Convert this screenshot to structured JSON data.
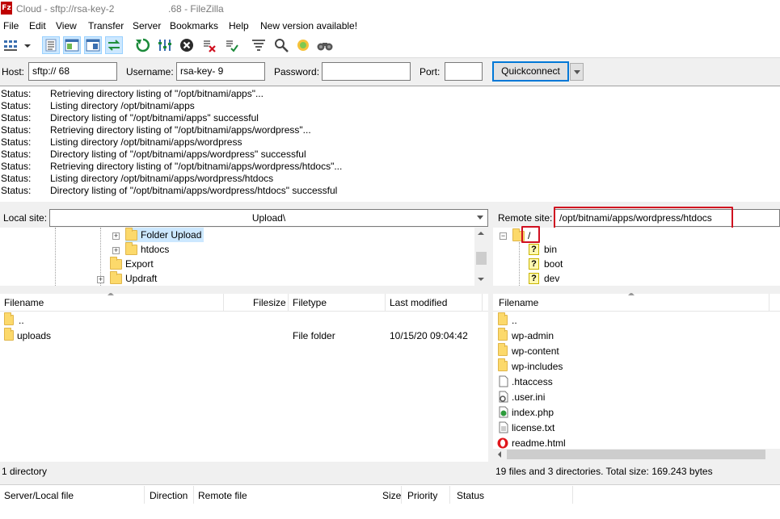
{
  "title": {
    "text": "Cloud - sftp://rsa-key-2                    .68 - FileZilla",
    "icon_letter": "Fz"
  },
  "menu": [
    "File",
    "Edit",
    "View",
    "Transfer",
    "Server",
    "Bookmarks",
    "Help",
    "New version available!"
  ],
  "toolbar_icons": [
    "site-manager-icon",
    "toggle-message-log-icon",
    "toggle-local-tree-icon",
    "toggle-remote-tree-icon",
    "toggle-queue-icon",
    "refresh-icon",
    "process-queue-icon",
    "cancel-icon",
    "disconnect-icon",
    "reconnect-icon",
    "directory-filter-icon",
    "search-remote-icon",
    "compare-icon",
    "find-files-icon"
  ],
  "quickconnect": {
    "host_label": "Host:",
    "host_value": "sftp://            68",
    "username_label": "Username:",
    "username_value": "rsa-key-            9",
    "password_label": "Password:",
    "password_value": "",
    "port_label": "Port:",
    "port_value": "",
    "button": "Quickconnect"
  },
  "log": [
    {
      "label": "Status:",
      "msg": "Retrieving directory listing of \"/opt/bitnami/apps\"..."
    },
    {
      "label": "Status:",
      "msg": "Listing directory /opt/bitnami/apps"
    },
    {
      "label": "Status:",
      "msg": "Directory listing of \"/opt/bitnami/apps\" successful"
    },
    {
      "label": "Status:",
      "msg": "Retrieving directory listing of \"/opt/bitnami/apps/wordpress\"..."
    },
    {
      "label": "Status:",
      "msg": "Listing directory /opt/bitnami/apps/wordpress"
    },
    {
      "label": "Status:",
      "msg": "Directory listing of \"/opt/bitnami/apps/wordpress\" successful"
    },
    {
      "label": "Status:",
      "msg": "Retrieving directory listing of \"/opt/bitnami/apps/wordpress/htdocs\"..."
    },
    {
      "label": "Status:",
      "msg": "Listing directory /opt/bitnami/apps/wordpress/htdocs"
    },
    {
      "label": "Status:",
      "msg": "Directory listing of \"/opt/bitnami/apps/wordpress/htdocs\" successful"
    }
  ],
  "local": {
    "label": "Local site:",
    "path": "Upload\\",
    "tree": [
      "Folder Upload",
      "htdocs",
      "Export",
      "Updraft"
    ],
    "columns": [
      "Filename",
      "Filesize",
      "Filetype",
      "Last modified"
    ],
    "files": [
      {
        "name": "..",
        "size": "",
        "type": "",
        "modified": ""
      },
      {
        "name": "uploads",
        "size": "",
        "type": "File folder",
        "modified": "10/15/20 09:04:42"
      }
    ],
    "status": "1 directory"
  },
  "remote": {
    "label": "Remote site:",
    "path": "/opt/bitnami/apps/wordpress/htdocs",
    "tree": [
      "/",
      "bin",
      "boot",
      "dev"
    ],
    "columns": [
      "Filename"
    ],
    "files": [
      "..",
      "wp-admin",
      "wp-content",
      "wp-includes",
      ".htaccess",
      ".user.ini",
      "index.php",
      "license.txt",
      "readme.html"
    ],
    "status": "19 files and 3 directories. Total size: 169.243 bytes"
  },
  "queue_columns": [
    "Server/Local file",
    "Direction",
    "Remote file",
    "Size",
    "Priority",
    "Status"
  ],
  "colors": {
    "highlight": "#d01020",
    "folder": "#fcd96b",
    "app_icon": "#bf0000"
  }
}
